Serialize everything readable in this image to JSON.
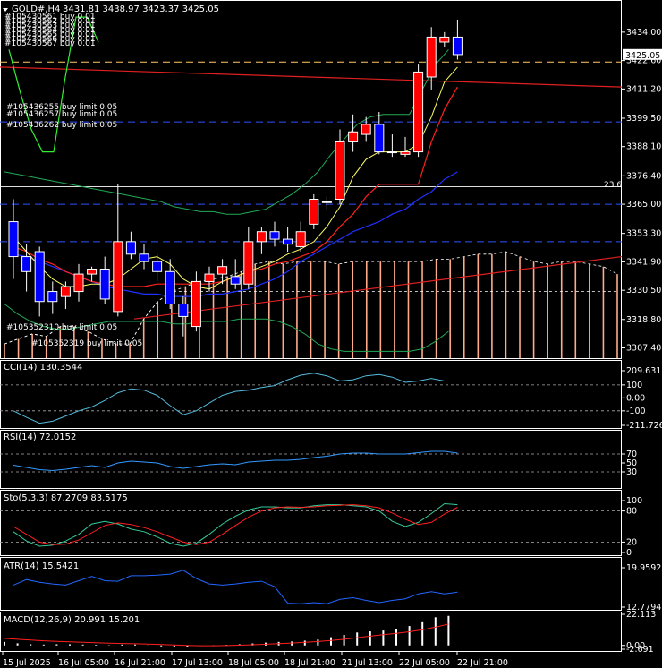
{
  "header": {
    "symbol": "GOLD#,H4",
    "ohlc": "3431.81 3438.97 3423.37 3425.05"
  },
  "colors": {
    "bull": "#ff0000",
    "bear": "#0000ff",
    "ma_fast": "#ffff66",
    "ma_red": "#ff2020",
    "ma_blue": "#2030ff",
    "bands": "#22aa55",
    "envelope_lime": "#33ee33",
    "trend_red": "#e02020",
    "order_line": "#3050ff",
    "bid_line": "#ffcc66",
    "fib_line": "#ffffff",
    "histogram": "#ffaa88",
    "cci": "#55bbdd",
    "rsi": "#3399ff",
    "stoch_main": "#33cc99",
    "stoch_signal": "#ff2020",
    "atr": "#2266ff",
    "macd_hist": "#ffffff",
    "macd_signal": "#ff2020"
  },
  "orders": {
    "stacked_top": [
      "#105430561 buy 0.01",
      "#105430562 buy 0.01",
      "#105430563 buy 0.01",
      "#105430564 buy 0.01",
      "#105430565 buy 0.01",
      "#105430566 buy 0.01",
      "#105430567 buy 0.01"
    ],
    "limits_upper": [
      "#105436255 buy limit 0.05",
      "#105436257 buy limit 0.05",
      "#105436262 buy limit 0.05"
    ],
    "limits_lower": [
      "#105352310 buy limit 0.05",
      "#105352319 buy limit 0.05"
    ]
  },
  "fib_label": "23.6",
  "current_price_label": "3425.05",
  "chart_data": [
    {
      "type": "candlestick",
      "title": "GOLD#,H4",
      "ylim": [
        3304,
        3444
      ],
      "yticks": [
        "3434.00",
        "3422.60",
        "3411.20",
        "3399.50",
        "3388.10",
        "3376.40",
        "3365.00",
        "3353.30",
        "3341.90",
        "3330.50",
        "3318.80",
        "3307.40"
      ],
      "candles": [
        {
          "o": 3358.0,
          "h": 3367.0,
          "l": 3335.0,
          "c": 3344.0
        },
        {
          "o": 3344.0,
          "h": 3349.0,
          "l": 3330.0,
          "c": 3338.0
        },
        {
          "o": 3346.0,
          "h": 3348.0,
          "l": 3320.0,
          "c": 3326.0
        },
        {
          "o": 3330.0,
          "h": 3334.0,
          "l": 3321.0,
          "c": 3326.0
        },
        {
          "o": 3328.0,
          "h": 3334.0,
          "l": 3323.0,
          "c": 3332.0
        },
        {
          "o": 3330.0,
          "h": 3341.0,
          "l": 3326.0,
          "c": 3337.0
        },
        {
          "o": 3337.0,
          "h": 3340.0,
          "l": 3334.0,
          "c": 3339.0
        },
        {
          "o": 3339.0,
          "h": 3344.0,
          "l": 3325.0,
          "c": 3327.0
        },
        {
          "o": 3322.0,
          "h": 3373.0,
          "l": 3320.0,
          "c": 3350.0
        },
        {
          "o": 3350.0,
          "h": 3354.0,
          "l": 3343.0,
          "c": 3345.0
        },
        {
          "o": 3345.0,
          "h": 3349.0,
          "l": 3339.0,
          "c": 3342.0
        },
        {
          "o": 3342.0,
          "h": 3345.0,
          "l": 3334.0,
          "c": 3338.0
        },
        {
          "o": 3338.0,
          "h": 3343.0,
          "l": 3323.0,
          "c": 3325.0
        },
        {
          "o": 3325.0,
          "h": 3328.0,
          "l": 3312.0,
          "c": 3320.0
        },
        {
          "o": 3316.0,
          "h": 3338.0,
          "l": 3314.0,
          "c": 3334.0
        },
        {
          "o": 3334.0,
          "h": 3340.0,
          "l": 3330.0,
          "c": 3337.0
        },
        {
          "o": 3337.0,
          "h": 3343.0,
          "l": 3333.0,
          "c": 3340.0
        },
        {
          "o": 3336.0,
          "h": 3343.0,
          "l": 3331.0,
          "c": 3333.0
        },
        {
          "o": 3333.0,
          "h": 3356.0,
          "l": 3331.0,
          "c": 3350.0
        },
        {
          "o": 3350.0,
          "h": 3356.0,
          "l": 3345.0,
          "c": 3354.0
        },
        {
          "o": 3354.0,
          "h": 3358.0,
          "l": 3348.0,
          "c": 3351.0
        },
        {
          "o": 3351.0,
          "h": 3356.0,
          "l": 3346.0,
          "c": 3349.0
        },
        {
          "o": 3348.0,
          "h": 3358.0,
          "l": 3346.0,
          "c": 3354.0
        },
        {
          "o": 3357.0,
          "h": 3369.0,
          "l": 3355.0,
          "c": 3367.0
        },
        {
          "o": 3366.0,
          "h": 3368.0,
          "l": 3363.0,
          "c": 3366.0
        },
        {
          "o": 3367.0,
          "h": 3395.0,
          "l": 3365.0,
          "c": 3390.0
        },
        {
          "o": 3390.0,
          "h": 3401.0,
          "l": 3386.0,
          "c": 3394.0
        },
        {
          "o": 3393.0,
          "h": 3400.0,
          "l": 3390.0,
          "c": 3397.0
        },
        {
          "o": 3397.0,
          "h": 3402.0,
          "l": 3385.0,
          "c": 3386.0
        },
        {
          "o": 3386.0,
          "h": 3393.0,
          "l": 3384.0,
          "c": 3386.0
        },
        {
          "o": 3385.0,
          "h": 3392.0,
          "l": 3384.0,
          "c": 3386.0
        },
        {
          "o": 3386.0,
          "h": 3421.0,
          "l": 3384.0,
          "c": 3418.0
        },
        {
          "o": 3416.0,
          "h": 3436.0,
          "l": 3411.0,
          "c": 3432.0
        },
        {
          "o": 3430.0,
          "h": 3434.0,
          "l": 3428.0,
          "c": 3432.0
        },
        {
          "o": 3432.0,
          "h": 3439.0,
          "l": 3423.0,
          "c": 3425.0
        }
      ],
      "ma_fast": [
        3352,
        3346,
        3340,
        3335,
        3332,
        3332,
        3333,
        3333,
        3335,
        3339,
        3343,
        3344,
        3341,
        3335,
        3332,
        3331,
        3334,
        3336,
        3338,
        3340,
        3342,
        3345,
        3347,
        3350,
        3356,
        3364,
        3376,
        3383,
        3386,
        3386,
        3386,
        3389,
        3400,
        3414,
        3420
      ],
      "ma_red": [
        3348,
        3346,
        3343,
        3341,
        3338,
        3336,
        3334,
        3333,
        3332,
        3332,
        3332,
        3333,
        3333,
        3333,
        3333,
        3333,
        3334,
        3336,
        3338,
        3339,
        3341,
        3342,
        3344,
        3346,
        3350,
        3356,
        3361,
        3368,
        3373,
        3373,
        3373,
        3373,
        3390,
        3403,
        3412
      ],
      "ma_blue": [
        3345,
        3344,
        3342,
        3340,
        3338,
        3336,
        3334,
        3332,
        3331,
        3330,
        3329,
        3329,
        3328,
        3328,
        3328,
        3329,
        3329,
        3330,
        3331,
        3333,
        3335,
        3338,
        3342,
        3345,
        3348,
        3351,
        3354,
        3356,
        3358,
        3361,
        3363,
        3367,
        3370,
        3375,
        3378
      ],
      "band_upper": [
        3378,
        3377,
        3376,
        3375,
        3374,
        3373,
        3372,
        3371,
        3370,
        3369,
        3368,
        3367,
        3366,
        3364,
        3363,
        3362,
        3362,
        3361,
        3361,
        3362,
        3363,
        3366,
        3369,
        3373,
        3378,
        3385,
        3391,
        3397,
        3400,
        3401,
        3401,
        3401,
        3411,
        3421,
        3427
      ],
      "band_lower": [
        3325,
        3321,
        3318,
        3316,
        3315,
        3315,
        3316,
        3317,
        3318,
        3318,
        3318,
        3318,
        3318,
        3317,
        3317,
        3318,
        3318,
        3318,
        3319,
        3319,
        3319,
        3318,
        3316,
        3313,
        3309,
        3307,
        3306,
        3306,
        3306,
        3306,
        3306,
        3306,
        3307,
        3310,
        3314
      ],
      "envelope_lime": [
        3427,
        3410,
        3395,
        3386,
        3386,
        3415,
        3440,
        3440,
        3430
      ],
      "histogram": [
        3309,
        3311,
        3313,
        3312,
        3316,
        3316,
        3314,
        3311,
        3309,
        3309,
        3319,
        3326,
        3330,
        3332,
        3334,
        3335,
        3336,
        3338,
        3341,
        3342,
        3341,
        3342,
        3342,
        3342,
        3341,
        3342,
        3342,
        3342,
        3342,
        3342,
        3342,
        3343,
        3343,
        3344,
        3345,
        3345,
        3346,
        3344,
        3342,
        3341,
        3342,
        3342,
        3341,
        3340,
        3337
      ],
      "levels": {
        "trend_red_start": 3420,
        "trend_red_end": 3412,
        "order_limits_upper": 3398,
        "order_limits_lower": 3365,
        "blue_dash_lower": 3350,
        "bid": 3422,
        "fib_23_6": 3372
      },
      "support_red_line_start": 3319,
      "support_red_line_end": 3344
    },
    {
      "type": "line",
      "title": "CCI(14) 130.3544",
      "ylim": [
        -211.7269,
        209.6315
      ],
      "yticks": [
        "209.6315",
        "100",
        "0.00",
        "-100",
        "-211.7269"
      ],
      "levels": [
        100,
        -100
      ],
      "series": [
        {
          "name": "CCI(14)",
          "values": [
            -100,
            -150,
            -195,
            -180,
            -140,
            -100,
            -70,
            -20,
            40,
            70,
            60,
            20,
            -60,
            -130,
            -100,
            -40,
            20,
            50,
            60,
            80,
            95,
            140,
            175,
            190,
            170,
            130,
            140,
            170,
            180,
            160,
            120,
            130,
            150,
            130,
            130
          ]
        }
      ]
    },
    {
      "type": "line",
      "title": "RSI(14) 72.0152",
      "ylim": [
        0,
        100
      ],
      "yticks": [
        "70",
        "50",
        "30"
      ],
      "levels": [
        70,
        30
      ],
      "series": [
        {
          "name": "RSI(14)",
          "values": [
            45,
            40,
            35,
            33,
            36,
            40,
            44,
            40,
            50,
            54,
            52,
            50,
            42,
            38,
            42,
            46,
            48,
            46,
            52,
            54,
            56,
            56,
            58,
            62,
            65,
            70,
            72,
            72,
            70,
            70,
            70,
            73,
            76,
            76,
            72
          ]
        }
      ]
    },
    {
      "type": "line",
      "title": "Sto(5,3,3) 87.2709 83.5175",
      "ylim": [
        0,
        100
      ],
      "yticks": [
        "100",
        "80",
        "20",
        "0"
      ],
      "levels": [
        80,
        20
      ],
      "series": [
        {
          "name": "Sto main",
          "values": [
            40,
            22,
            12,
            14,
            22,
            35,
            55,
            60,
            55,
            45,
            40,
            30,
            18,
            12,
            18,
            35,
            55,
            70,
            82,
            88,
            88,
            86,
            86,
            90,
            92,
            92,
            90,
            88,
            80,
            60,
            50,
            58,
            75,
            94,
            92
          ]
        },
        {
          "name": "Sto signal",
          "values": [
            50,
            35,
            20,
            15,
            16,
            24,
            38,
            52,
            57,
            54,
            48,
            40,
            30,
            20,
            15,
            20,
            35,
            52,
            68,
            80,
            86,
            88,
            87,
            88,
            90,
            91,
            92,
            90,
            86,
            76,
            64,
            54,
            58,
            74,
            87
          ]
        }
      ]
    },
    {
      "type": "line",
      "title": "ATR(14) 15.5421",
      "ylim": [
        12.7794,
        19.9592
      ],
      "yticks": [
        "19.9592",
        "12.7794"
      ],
      "series": [
        {
          "name": "ATR(14)",
          "values": [
            16.8,
            17.8,
            17.3,
            17.0,
            16.8,
            17.6,
            18.4,
            17.6,
            17.5,
            18.5,
            18.5,
            18.6,
            18.8,
            19.5,
            18.0,
            17.0,
            16.8,
            17.0,
            17.3,
            17.5,
            16.5,
            13.5,
            13.4,
            13.6,
            13.4,
            14.2,
            14.5,
            14.0,
            13.6,
            14.0,
            14.3,
            15.2,
            15.6,
            15.2,
            15.5
          ]
        }
      ]
    },
    {
      "type": "bar",
      "title": "MACD(12,26,9) 20.991 15.201",
      "ylim": [
        -2.69,
        22.113
      ],
      "yticks": [
        "22.113",
        "0.00",
        "-2.691"
      ],
      "series": [
        {
          "name": "MACD",
          "values": [
            2.5,
            1.5,
            0.8,
            0.6,
            0.8,
            0.8,
            0.6,
            0.4,
            0.2,
            0.6,
            0.6,
            0.1,
            -0.6,
            -1.2,
            -0.8,
            -0.4,
            0.2,
            0.4,
            0.8,
            1.4,
            2.0,
            2.5,
            2.8,
            3.4,
            4.2,
            5.8,
            7.5,
            9.2,
            10.0,
            10.6,
            11.8,
            13.8,
            16.5,
            20.0,
            21.0
          ]
        },
        {
          "name": "Signal",
          "values": [
            5.0,
            4.4,
            3.8,
            3.3,
            2.9,
            2.5,
            2.2,
            1.9,
            1.6,
            1.4,
            1.2,
            1.0,
            0.7,
            0.3,
            0.0,
            -0.2,
            -0.2,
            -0.1,
            0.2,
            0.5,
            0.9,
            1.3,
            1.7,
            2.2,
            2.8,
            3.5,
            4.4,
            5.5,
            6.6,
            7.6,
            8.6,
            9.7,
            11.1,
            13.0,
            15.2
          ]
        }
      ]
    }
  ],
  "x_labels": [
    "15 Jul 2025",
    "16 Jul 05:00",
    "16 Jul 21:00",
    "17 Jul 13:00",
    "18 Jul 05:00",
    "18 Jul 21:00",
    "21 Jul 13:00",
    "22 Jul 05:00",
    "22 Jul 21:00"
  ]
}
